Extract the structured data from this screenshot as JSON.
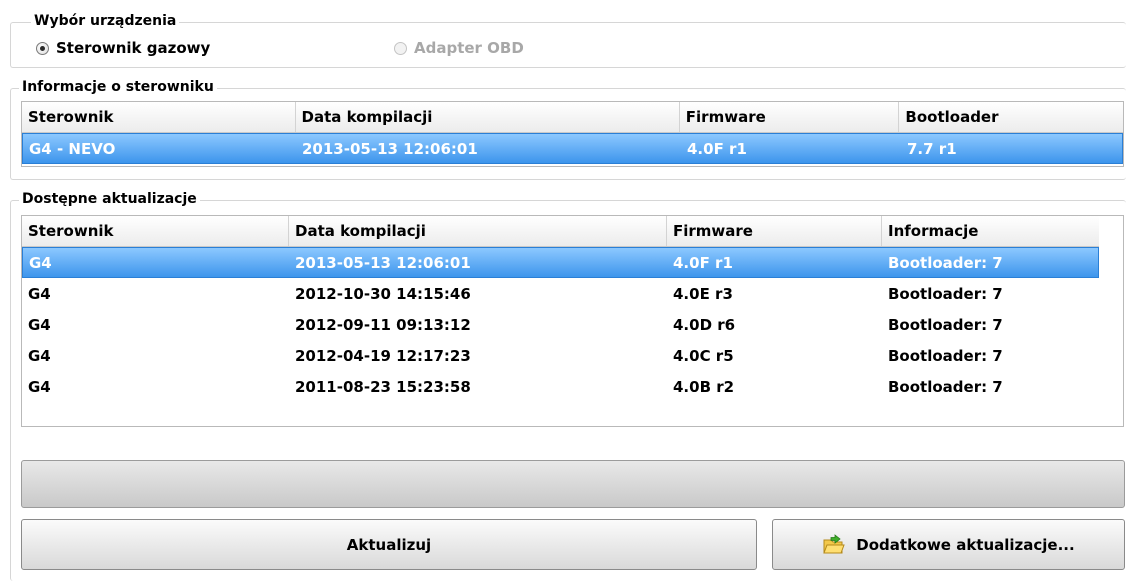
{
  "device_selection": {
    "title": "Wybór urządzenia",
    "options": [
      {
        "label": "Sterownik gazowy",
        "checked": true
      },
      {
        "label": "Adapter OBD",
        "checked": false,
        "disabled": true
      }
    ]
  },
  "controller_info": {
    "title": "Informacje o sterowniku",
    "columns": [
      "Sterownik",
      "Data kompilacji",
      "Firmware",
      "Bootloader"
    ],
    "rows": [
      [
        "G4 - NEVO",
        "2013-05-13 12:06:01",
        "4.0F r1",
        "7.7 r1"
      ]
    ]
  },
  "updates": {
    "title": "Dostępne aktualizacje",
    "columns": [
      "Sterownik",
      "Data kompilacji",
      "Firmware",
      "Informacje"
    ],
    "rows": [
      [
        "G4",
        "2013-05-13 12:06:01",
        "4.0F r1",
        "Bootloader: 7"
      ],
      [
        "G4",
        "2012-10-30 14:15:46",
        "4.0E r3",
        "Bootloader: 7"
      ],
      [
        "G4",
        "2012-09-11 09:13:12",
        "4.0D r6",
        "Bootloader: 7"
      ],
      [
        "G4",
        "2012-04-19 12:17:23",
        "4.0C r5",
        "Bootloader: 7"
      ],
      [
        "G4",
        "2011-08-23 15:23:58",
        "4.0B r2",
        "Bootloader: 7"
      ]
    ],
    "selected_index": 0
  },
  "progress": {
    "value": 0
  },
  "buttons": {
    "update": "Aktualizuj",
    "additional": "Dodatkowe aktualizacje..."
  },
  "icons": {
    "additional": "folder-open-arrow-icon"
  },
  "colors": {
    "selection_top": "#8cc8ff",
    "selection_bottom": "#3d95ec"
  }
}
